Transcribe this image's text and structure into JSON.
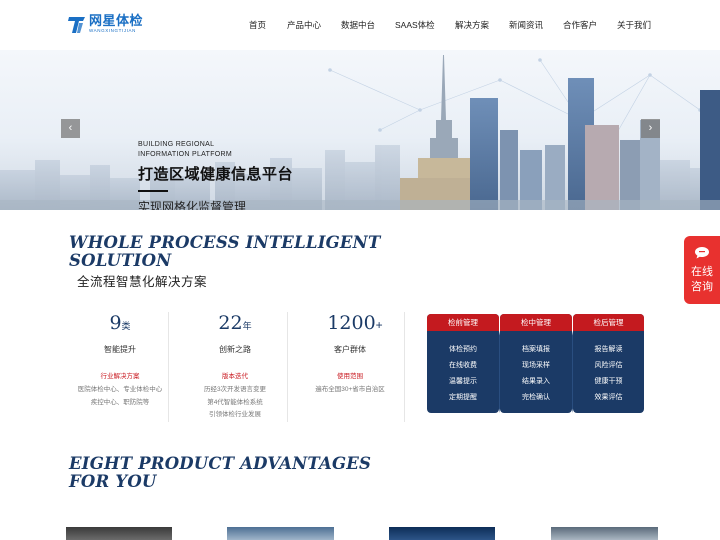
{
  "header": {
    "logo_cn": "网星体检",
    "logo_en": "WANGXINGTIJIAN",
    "nav": [
      "首页",
      "产品中心",
      "数据中台",
      "SAAS体检",
      "解决方案",
      "新闻资讯",
      "合作客户",
      "关于我们"
    ]
  },
  "banner": {
    "en_line1": "BUILDING REGIONAL",
    "en_line2": "INFORMATION PLATFORM",
    "title": "打造区域健康信息平台",
    "subtitle": "实现网格化监督管理",
    "prev": "‹",
    "next": "›"
  },
  "solution": {
    "en_line1": "WHOLE PROCESS INTELLIGENT",
    "en_line2": "SOLUTION",
    "cn": "全流程智慧化解决方案"
  },
  "stats": [
    {
      "num": "9",
      "unit": "类",
      "label": "智能提升",
      "tag": "行业解决方案",
      "desc": [
        "医院体检中心、专业体检中心",
        "疾控中心、职防院等"
      ]
    },
    {
      "num": "22",
      "unit": "年",
      "label": "创新之路",
      "tag": "版本迭代",
      "desc": [
        "历经3次开发语言变更",
        "第4代智能体检系统",
        "引领体检行业发展"
      ]
    },
    {
      "num": "1200",
      "unit": "+",
      "label": "客户群体",
      "tag": "使用范围",
      "desc": [
        "遍布全国30+省市自治区"
      ]
    }
  ],
  "process": [
    {
      "title": "检前管理",
      "items": [
        "体检预约",
        "在线收费",
        "温馨提示",
        "定期提醒"
      ]
    },
    {
      "title": "检中管理",
      "items": [
        "档案填报",
        "现场采样",
        "结果录入",
        "完检确认"
      ]
    },
    {
      "title": "检后管理",
      "items": [
        "报告解读",
        "风险评估",
        "健康干预",
        "效果评估"
      ]
    }
  ],
  "advantages": {
    "en_line1": "EIGHT PRODUCT ADVANTAGES",
    "en_line2": "FOR YOU"
  },
  "float_contact": {
    "line1": "在线",
    "line2": "咨询",
    "icon": "chat-bubble-icon"
  },
  "colors": {
    "brand_blue": "#1a6fc4",
    "navy": "#1b3a66",
    "accent_red": "#c41a1f",
    "float_red": "#e8312f"
  }
}
